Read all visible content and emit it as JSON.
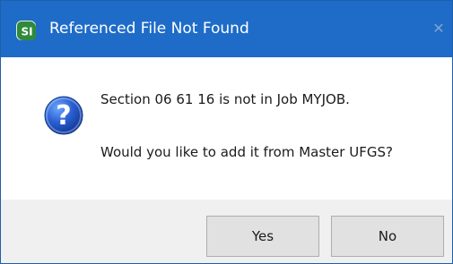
{
  "window": {
    "title": "Referenced File Not Found",
    "close_symbol": "✕"
  },
  "icons": {
    "app_icon": "app-icon",
    "question_icon": "question-icon"
  },
  "message": {
    "line1": "Section 06 61 16 is not in Job MYJOB.",
    "line2": "Would you like to add it from Master UFGS?"
  },
  "buttons": {
    "yes_label": "Yes",
    "no_label": "No"
  },
  "colors": {
    "titlebar": "#1e6cc8",
    "app_icon_bg": "#2f8a3a",
    "question_blue": "#2a5fd1",
    "footer_bg": "#f0f0f0"
  }
}
